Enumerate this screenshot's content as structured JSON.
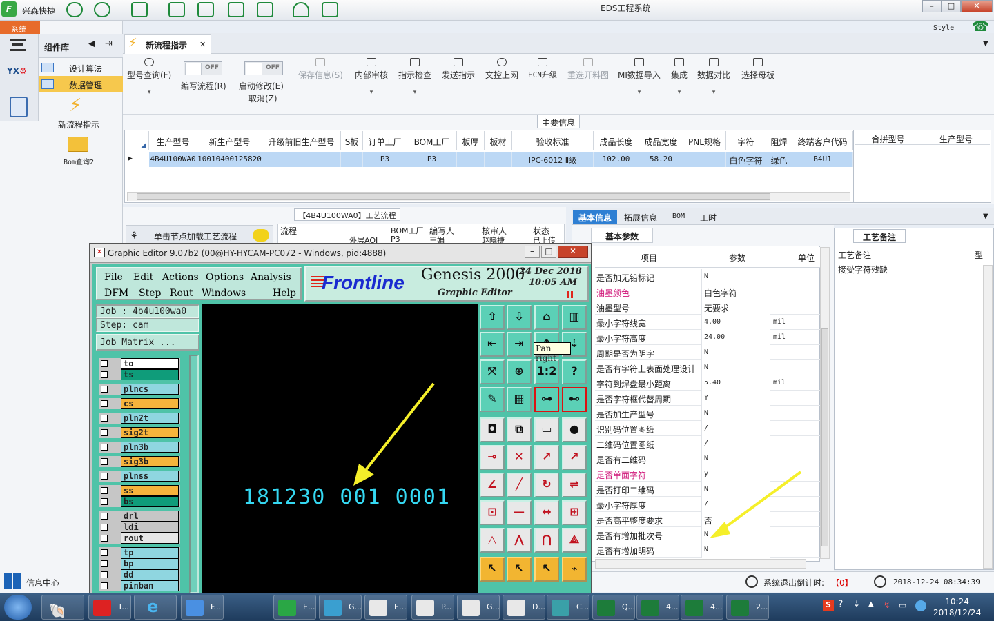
{
  "titlebar": {
    "app_name": "兴森快捷",
    "title": "EDS工程系统"
  },
  "sysbar": {
    "label": "系统"
  },
  "style_menu": "Style",
  "leftnav": {
    "header": "组件库",
    "items": [
      {
        "label": "设计算法"
      },
      {
        "label": "数据管理"
      }
    ],
    "launchers": [
      {
        "label": "新流程指示"
      },
      {
        "label": "Bom查询2"
      }
    ],
    "bottom_left": "信息中心"
  },
  "tab": {
    "label": "新流程指示"
  },
  "toolbar": {
    "model_query": "型号查询(F)",
    "toggle1": {
      "state": "OFF",
      "label": "编写流程(R)"
    },
    "toggle2": {
      "state": "OFF",
      "label": "启动修改(E)",
      "sub": "取消(Z)"
    },
    "save_info": "保存信息(S)",
    "internal_review": "内部审核",
    "instruction_check": "指示检查",
    "send_instruction": "发送指示",
    "upload_doc": "文控上网",
    "ecn_upgrade": "ECN升级",
    "reselect": "重选开料图",
    "mi_import": "MI数据导入",
    "integrate": "集成",
    "data_compare": "数据对比",
    "select_board": "选择母板"
  },
  "main_info": {
    "legend": "主要信息",
    "columns": [
      "生产型号",
      "新生产型号",
      "升级前旧生产型号",
      "S板",
      "订单工厂",
      "BOM工厂",
      "板厚",
      "板材",
      "验收标准",
      "成品长度",
      "成品宽度",
      "PNL规格",
      "字符",
      "阻焊",
      "终端客户代码"
    ],
    "row": [
      "4B4U100WA0",
      "10010400125820",
      "",
      "",
      "P3",
      "P3",
      "",
      "",
      "IPC-6012 Ⅱ级",
      "102.00",
      "58.20",
      "",
      "白色字符",
      "绿色",
      "B4U1"
    ],
    "right_columns": [
      "合拼型号",
      "生产型号"
    ]
  },
  "process": {
    "title": "【4B4U100WA0】工艺流程",
    "load_button": "单击节点加载工艺流程",
    "columns": [
      "流程",
      "BOM工厂",
      "编写人",
      "核审人",
      "状态"
    ],
    "row": [
      "外层AOI",
      "P3",
      "王娟",
      "赵晓捷",
      "已上传"
    ]
  },
  "info_tabs": [
    "基本信息",
    "拓展信息",
    "BOM",
    "工时"
  ],
  "basic_params": {
    "tab": "基本参数",
    "columns": [
      "项目",
      "参数",
      "单位"
    ],
    "rows": [
      {
        "name": "是否加无铅标记",
        "value": "N",
        "unit": ""
      },
      {
        "name": "油墨颜色",
        "value": "白色字符",
        "unit": ""
      },
      {
        "name": "油墨型号",
        "value": "无要求",
        "unit": ""
      },
      {
        "name": "最小字符线宽",
        "value": "4.00",
        "unit": "mil"
      },
      {
        "name": "最小字符高度",
        "value": "24.00",
        "unit": "mil"
      },
      {
        "name": "周期是否为阴字",
        "value": "N",
        "unit": ""
      },
      {
        "name": "是否有字符上表面处理设计",
        "value": "N",
        "unit": ""
      },
      {
        "name": "字符到焊盘最小距离",
        "value": "5.40",
        "unit": "mil"
      },
      {
        "name": "是否字符框代替周期",
        "value": "Y",
        "unit": ""
      },
      {
        "name": "是否加生产型号",
        "value": "N",
        "unit": ""
      },
      {
        "name": "识别码位置图纸",
        "value": "/",
        "unit": ""
      },
      {
        "name": "二维码位置图纸",
        "value": "/",
        "unit": ""
      },
      {
        "name": "是否有二维码",
        "value": "N",
        "unit": ""
      },
      {
        "name": "是否单面字符",
        "value": "y",
        "unit": ""
      },
      {
        "name": "是否打印二维码",
        "value": "N",
        "unit": ""
      },
      {
        "name": "最小字符厚度",
        "value": "/",
        "unit": ""
      },
      {
        "name": "是否高平整度要求",
        "value": "否",
        "unit": ""
      },
      {
        "name": "是否有增加批次号",
        "value": "N",
        "unit": ""
      },
      {
        "name": "是否有增加明码",
        "value": "N",
        "unit": ""
      }
    ]
  },
  "notes": {
    "tab": "工艺备注",
    "col1": "工艺备注",
    "col2": "型",
    "text": "接受字符残缺"
  },
  "status": {
    "exit_label": "系统退出倒计时:",
    "exit_value": "【0】",
    "datetime": "2018-12-24 08:34:39"
  },
  "graphic_editor": {
    "title": "Graphic Editor 9.07b2 (00@HY-HYCAM-PC072 - Windows, pid:4888)",
    "menu_row1": [
      "File",
      "Edit",
      "Actions",
      "Options",
      "Analysis"
    ],
    "menu_row2": [
      "DFM",
      "Step",
      "Rout",
      "Windows",
      "Help"
    ],
    "brand": "Frontline",
    "product": "Genesis 2000",
    "subtitle": "Graphic Editor",
    "date": "24 Dec 2018",
    "time": "10:05 AM",
    "job": "Job : 4b4u100wa0",
    "step": "Step: cam",
    "job_matrix": "Job Matrix ...",
    "canvas_text": "181230 001 0001",
    "tooltip": "Pan right",
    "layers": [
      {
        "name": "to",
        "color": "#ffffff"
      },
      {
        "name": "ts",
        "color": "#0f9c7a"
      },
      {
        "name": "plncs",
        "color": "#8fd6e0"
      },
      {
        "name": "cs",
        "color": "#f6b43c"
      },
      {
        "name": "pln2t",
        "color": "#8fd6e0"
      },
      {
        "name": "sig2t",
        "color": "#f6b43c"
      },
      {
        "name": "pln3b",
        "color": "#8fd6e0"
      },
      {
        "name": "sig3b",
        "color": "#f6b43c"
      },
      {
        "name": "plnss",
        "color": "#8fd6e0"
      },
      {
        "name": "ss",
        "color": "#f6b43c"
      },
      {
        "name": "bs",
        "color": "#0f9c7a"
      },
      {
        "name": "drl",
        "color": "#c6c6c6"
      },
      {
        "name": "ldi",
        "color": "#c6c6c6"
      },
      {
        "name": "rout",
        "color": "#e6e6e6"
      },
      {
        "name": "tp",
        "color": "#8fd6e0"
      },
      {
        "name": "bp",
        "color": "#8fd6e0"
      },
      {
        "name": "dd",
        "color": "#8fd6e0"
      },
      {
        "name": "pinban",
        "color": "#8fd6e0"
      }
    ]
  },
  "taskbar": {
    "items": [
      "T...",
      "F...",
      "E...",
      "G...",
      "E...",
      "P...",
      "G...",
      "D...",
      "C...",
      "Q...",
      "4...",
      "4...",
      "2..."
    ],
    "clock_time": "10:24",
    "clock_date": "2018/12/24"
  }
}
